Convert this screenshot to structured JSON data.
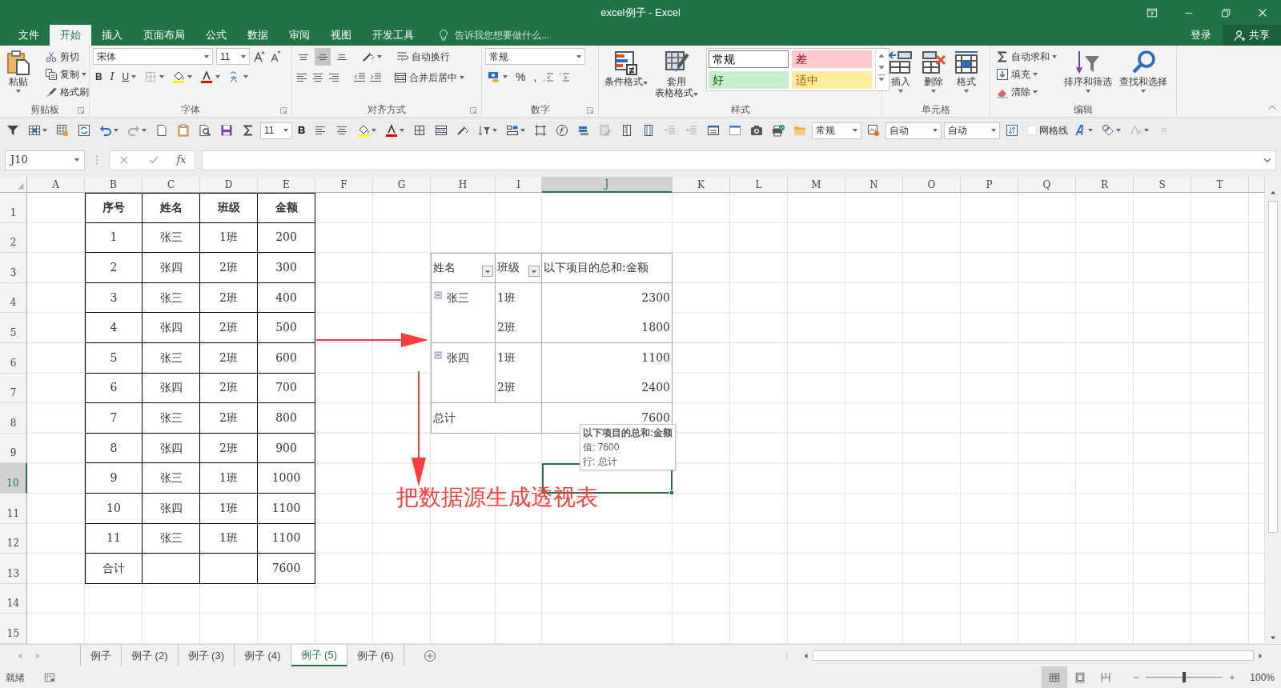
{
  "window": {
    "title": "excel例子 - Excel"
  },
  "ribbon_tabs": [
    {
      "label": "文件",
      "selected": false
    },
    {
      "label": "开始",
      "selected": true
    },
    {
      "label": "插入",
      "selected": false
    },
    {
      "label": "页面布局",
      "selected": false
    },
    {
      "label": "公式",
      "selected": false
    },
    {
      "label": "数据",
      "selected": false
    },
    {
      "label": "审阅",
      "selected": false
    },
    {
      "label": "视图",
      "selected": false
    },
    {
      "label": "开发工具",
      "selected": false
    }
  ],
  "tell_me": {
    "placeholder": "告诉我您想要做什么..."
  },
  "account": {
    "sign_in": "登录",
    "share": "共享"
  },
  "ribbon": {
    "clipboard": {
      "label": "剪贴板",
      "paste": "粘贴",
      "items": [
        "剪切",
        "复制",
        "格式刷"
      ]
    },
    "font": {
      "label": "字体",
      "font_name": "宋体",
      "font_size": "11",
      "style_buttons": [
        "B",
        "I",
        "U"
      ]
    },
    "alignment": {
      "label": "对齐方式",
      "vertical": [
        {
          "selected": false
        },
        {
          "selected": true
        },
        {
          "selected": false
        }
      ],
      "wrap_text": "自动换行",
      "merge": "合并后居中"
    },
    "number": {
      "label": "数字",
      "format": "常规",
      "symbols": [
        "%",
        ","
      ]
    },
    "styles": {
      "label": "样式",
      "buttons": [
        [
          "条件格式"
        ],
        [
          "套用",
          "表格格式"
        ]
      ],
      "cell_styles": [
        {
          "label": "常规",
          "kind": "normal"
        },
        {
          "label": "差",
          "kind": "bad"
        },
        {
          "label": "好",
          "kind": "good"
        },
        {
          "label": "适中",
          "kind": "neutral"
        }
      ]
    },
    "cells": {
      "label": "单元格",
      "buttons": [
        "插入",
        "删除",
        "格式"
      ]
    },
    "editing": {
      "label": "编辑",
      "items": [
        "自动求和",
        "填充",
        "清除"
      ],
      "buttons": [
        "排序和筛选",
        "查找和选择"
      ]
    }
  },
  "quick_toolbar": {
    "font_size": "11",
    "bold": "B",
    "number_format": "常规",
    "dropdowns": [
      "自动",
      "自动"
    ],
    "gridlines": {
      "label": "网格线",
      "checked": false
    }
  },
  "formula_bar": {
    "name_box": "J10",
    "fx": "fx"
  },
  "sheet": {
    "columns": [
      {
        "label": "A",
        "selected": false
      },
      {
        "label": "B",
        "selected": false
      },
      {
        "label": "C",
        "selected": false
      },
      {
        "label": "D",
        "selected": false
      },
      {
        "label": "E",
        "selected": false
      },
      {
        "label": "F",
        "selected": false
      },
      {
        "label": "G",
        "selected": false
      },
      {
        "label": "H",
        "selected": false
      },
      {
        "label": "I",
        "selected": false
      },
      {
        "label": "J",
        "selected": true
      },
      {
        "label": "K",
        "selected": false
      },
      {
        "label": "L",
        "selected": false
      },
      {
        "label": "M",
        "selected": false
      },
      {
        "label": "N",
        "selected": false
      },
      {
        "label": "O",
        "selected": false
      },
      {
        "label": "P",
        "selected": false
      },
      {
        "label": "Q",
        "selected": false
      },
      {
        "label": "R",
        "selected": false
      },
      {
        "label": "S",
        "selected": false
      },
      {
        "label": "T",
        "selected": false
      }
    ],
    "rows": [
      {
        "label": "1",
        "selected": false
      },
      {
        "label": "2",
        "selected": false
      },
      {
        "label": "3",
        "selected": false
      },
      {
        "label": "4",
        "selected": false
      },
      {
        "label": "5",
        "selected": false
      },
      {
        "label": "6",
        "selected": false
      },
      {
        "label": "7",
        "selected": false
      },
      {
        "label": "8",
        "selected": false
      },
      {
        "label": "9",
        "selected": false
      },
      {
        "label": "10",
        "selected": true
      },
      {
        "label": "11",
        "selected": false
      },
      {
        "label": "12",
        "selected": false
      },
      {
        "label": "13",
        "selected": false
      },
      {
        "label": "14",
        "selected": false
      },
      {
        "label": "15",
        "selected": false
      }
    ]
  },
  "source_table": {
    "columns": [
      "序号",
      "姓名",
      "班级",
      "金额"
    ],
    "rows": [
      [
        "1",
        "张三",
        "1班",
        "200"
      ],
      [
        "2",
        "张四",
        "2班",
        "300"
      ],
      [
        "3",
        "张三",
        "2班",
        "400"
      ],
      [
        "4",
        "张四",
        "2班",
        "500"
      ],
      [
        "5",
        "张三",
        "2班",
        "600"
      ],
      [
        "6",
        "张四",
        "2班",
        "700"
      ],
      [
        "7",
        "张三",
        "2班",
        "800"
      ],
      [
        "8",
        "张四",
        "2班",
        "900"
      ],
      [
        "9",
        "张三",
        "1班",
        "1000"
      ],
      [
        "10",
        "张四",
        "1班",
        "1100"
      ],
      [
        "11",
        "张三",
        "1班",
        "1100"
      ]
    ],
    "total": {
      "label": "合计",
      "value": "7600"
    }
  },
  "pivot_table": {
    "headers": [
      {
        "label": "姓名",
        "filter": true
      },
      {
        "label": "班级",
        "filter": true
      },
      {
        "label": "以下项目的总和:金额",
        "filter": false
      }
    ],
    "groups": [
      {
        "name": "张三",
        "expanded": true,
        "items": [
          {
            "class": "1班",
            "value": "2300"
          },
          {
            "class": "2班",
            "value": "1800"
          }
        ]
      },
      {
        "name": "张四",
        "expanded": true,
        "items": [
          {
            "class": "1班",
            "value": "1100"
          },
          {
            "class": "2班",
            "value": "2400"
          }
        ]
      }
    ],
    "total": {
      "label": "总计",
      "value": "7600"
    }
  },
  "tooltip": {
    "title": "以下项目的总和:金额",
    "lines": [
      "值: 7600",
      "行: 总计"
    ]
  },
  "annotation": {
    "text": "把数据源生成透视表"
  },
  "sheet_tabs": [
    {
      "label": "例子",
      "selected": false
    },
    {
      "label": "例子 (2)",
      "selected": false
    },
    {
      "label": "例子 (3)",
      "selected": false
    },
    {
      "label": "例子 (4)",
      "selected": false
    },
    {
      "label": "例子 (5)",
      "selected": true
    },
    {
      "label": "例子 (6)",
      "selected": false
    }
  ],
  "status_bar": {
    "status": "就绪",
    "views": [
      {
        "selected": true
      },
      {
        "selected": false
      },
      {
        "selected": false
      }
    ],
    "zoom": {
      "level": 0.5,
      "reading": "100%"
    }
  }
}
